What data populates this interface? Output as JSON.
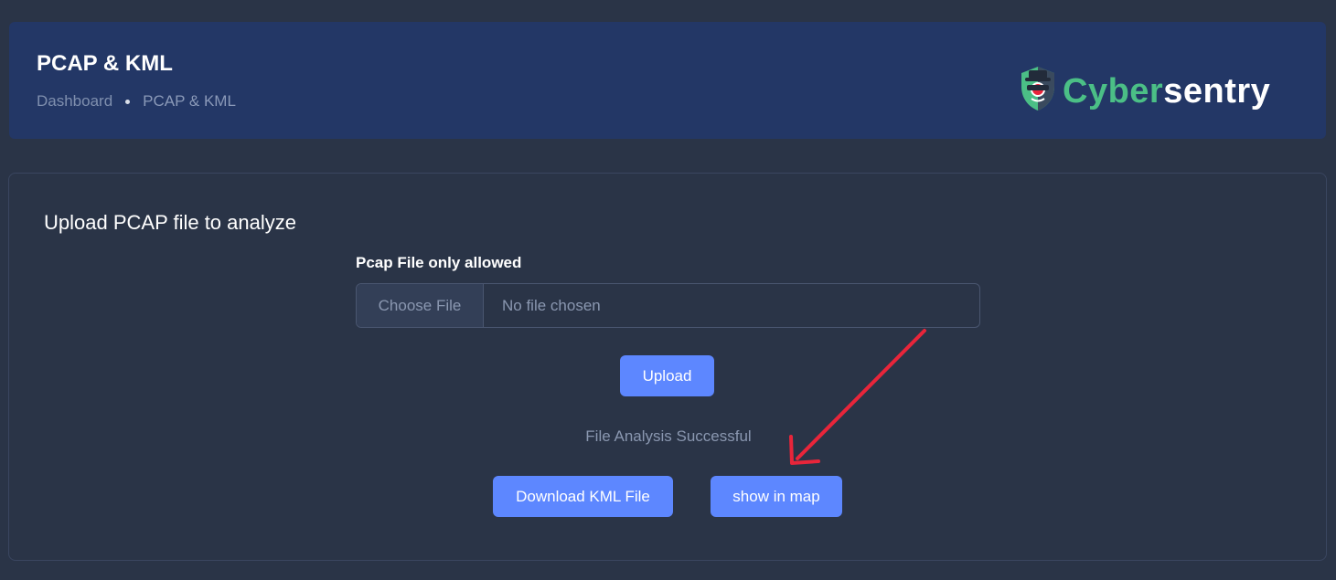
{
  "header": {
    "title": "PCAP & KML",
    "breadcrumb": [
      {
        "label": "Dashboard"
      },
      {
        "label": "PCAP & KML"
      }
    ],
    "logo": {
      "part1": "Cyber",
      "part2": "sentry",
      "icon": "shield-spy-icon",
      "colors": {
        "cyber": "#4bbf86",
        "sentry": "#ffffff"
      }
    }
  },
  "upload_card": {
    "title": "Upload PCAP file to analyze",
    "field_label": "Pcap File only allowed",
    "choose_label": "Choose File",
    "file_status": "No file chosen",
    "upload_label": "Upload",
    "status_message": "File Analysis Successful",
    "download_label": "Download KML File",
    "map_label": "show in map"
  },
  "annotation": {
    "arrow_color": "#e8253a"
  },
  "colors": {
    "background": "#2a3447",
    "header_bg": "#233766",
    "primary": "#5d87ff"
  }
}
